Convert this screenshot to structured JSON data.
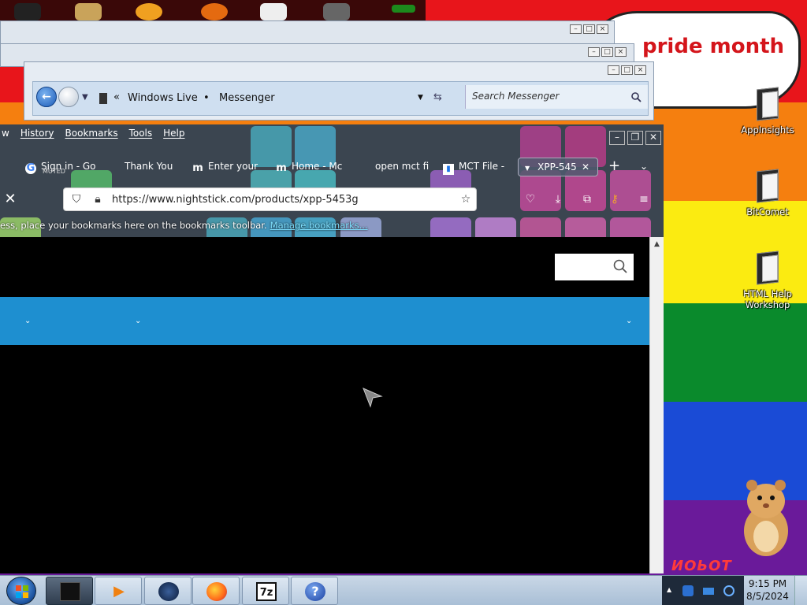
{
  "desktop": {
    "banner_text": "pride month",
    "banner_excl": "!",
    "icons": [
      {
        "label": "AppInsights"
      },
      {
        "label": "BitComet"
      },
      {
        "label": "HTML Help Workshop"
      }
    ],
    "hamster_caption": "ИОЬОТ"
  },
  "messenger_window": {
    "breadcrumb": [
      "Windows Live",
      "Messenger"
    ],
    "search_placeholder": "Search Messenger"
  },
  "firefox": {
    "menu": [
      "w",
      "History",
      "Bookmarks",
      "Tools",
      "Help"
    ],
    "tabs": [
      {
        "title": "Sign in - Go",
        "sub": "MUTED",
        "icon": "google-icon"
      },
      {
        "title": "Thank You",
        "icon": "thank-you-icon"
      },
      {
        "title": "Enter your",
        "icon": "m-icon"
      },
      {
        "title": "Home - Mc",
        "icon": "m-icon"
      },
      {
        "title": "open mct fi",
        "icon": "search-icon"
      },
      {
        "title": "MCT File -",
        "icon": "doc-icon"
      },
      {
        "title": "XPP-545",
        "icon": "dropdown-icon",
        "active": true
      }
    ],
    "url": "https://www.nightstick.com/products/xpp-5453g",
    "bookmarks_hint": "ess, place your bookmarks here on the bookmarks toolbar.",
    "manage_bookmarks": "Manage bookmarks..."
  },
  "taskbar": {
    "time": "9:15 PM",
    "date": "8/5/2024",
    "apps": [
      "terminal",
      "media-player",
      "globe",
      "firefox",
      "7zip",
      "help"
    ],
    "seven_zip_label": "7z",
    "help_label": "?"
  },
  "colors": {
    "nav_blue": "#1e8fd0",
    "rainbow": [
      "#e8151b",
      "#f57f0f",
      "#fbeb11",
      "#0a8a2c",
      "#1a4bd6",
      "#6a1a9a"
    ]
  }
}
